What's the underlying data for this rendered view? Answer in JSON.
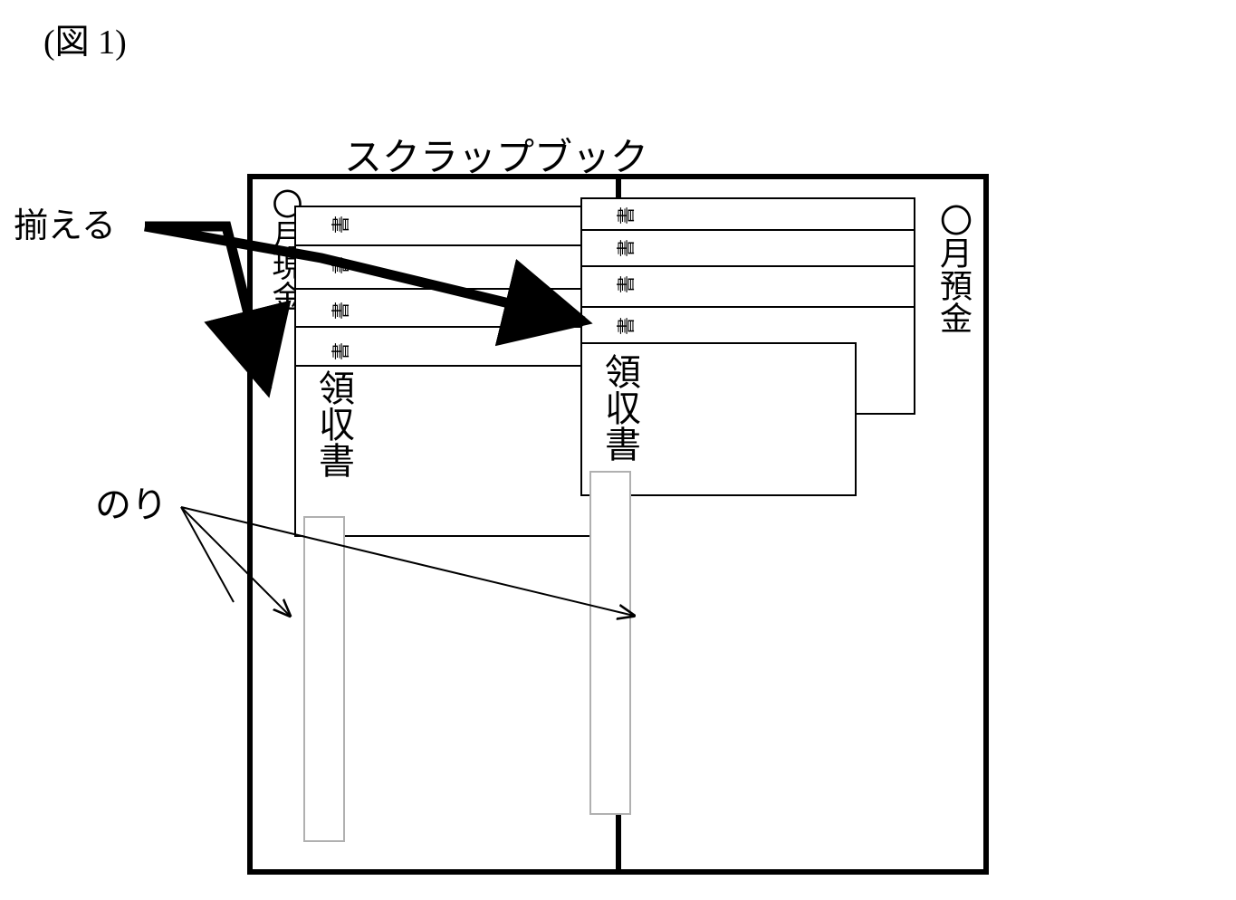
{
  "figure_number": "(図 1)",
  "title": "スクラップブック",
  "labels": {
    "align": "揃える",
    "glue": "のり"
  },
  "pages": {
    "left_tab": "〇月現金",
    "right_tab": "〇月預金"
  },
  "receipt_text": "領収書",
  "receipt_fragment": "書"
}
